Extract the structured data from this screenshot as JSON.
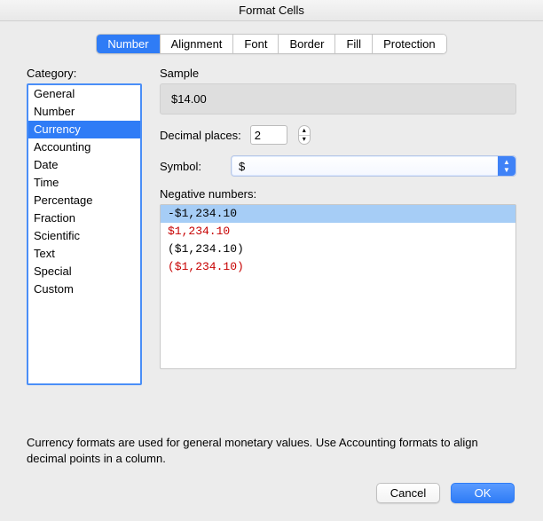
{
  "window": {
    "title": "Format Cells"
  },
  "tabs": [
    {
      "label": "Number",
      "active": true
    },
    {
      "label": "Alignment",
      "active": false
    },
    {
      "label": "Font",
      "active": false
    },
    {
      "label": "Border",
      "active": false
    },
    {
      "label": "Fill",
      "active": false
    },
    {
      "label": "Protection",
      "active": false
    }
  ],
  "category": {
    "label": "Category:",
    "items": [
      "General",
      "Number",
      "Currency",
      "Accounting",
      "Date",
      "Time",
      "Percentage",
      "Fraction",
      "Scientific",
      "Text",
      "Special",
      "Custom"
    ],
    "selected_index": 2
  },
  "sample": {
    "label": "Sample",
    "value": "$14.00"
  },
  "decimals": {
    "label": "Decimal places:",
    "value": "2"
  },
  "symbol": {
    "label": "Symbol:",
    "value": "$"
  },
  "negative": {
    "label": "Negative numbers:",
    "items": [
      {
        "text": "-$1,234.10",
        "red": false
      },
      {
        "text": "$1,234.10",
        "red": true
      },
      {
        "text": "($1,234.10)",
        "red": false
      },
      {
        "text": "($1,234.10)",
        "red": true
      }
    ],
    "selected_index": 0
  },
  "description": "Currency formats are used for general monetary values.  Use Accounting formats to align decimal points in a column.",
  "buttons": {
    "cancel": "Cancel",
    "ok": "OK"
  }
}
